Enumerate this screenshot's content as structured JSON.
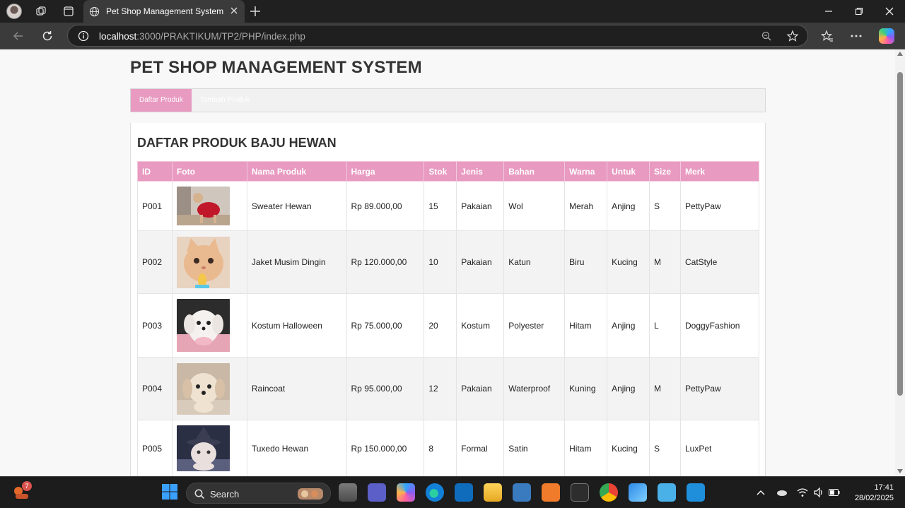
{
  "browser": {
    "tab_title": "Pet Shop Management System",
    "url_host": "localhost",
    "url_path": ":3000/PRAKTIKUM/TP2/PHP/index.php"
  },
  "page": {
    "title": "PET SHOP MANAGEMENT SYSTEM",
    "menu": [
      {
        "label": "Daftar Produk",
        "active": true
      },
      {
        "label": "Tambah Produk",
        "active": false
      }
    ],
    "section_title": "DAFTAR PRODUK BAJU HEWAN",
    "table": {
      "headers": [
        "ID",
        "Foto",
        "Nama Produk",
        "Harga",
        "Stok",
        "Jenis",
        "Bahan",
        "Warna",
        "Untuk",
        "Size",
        "Merk"
      ],
      "rows": [
        {
          "id": "P001",
          "photo": "dog in red sweater",
          "name": "Sweater Hewan",
          "price": "Rp 89.000,00",
          "stock": "15",
          "type": "Pakaian",
          "material": "Wol",
          "color": "Merah",
          "for": "Anjing",
          "size": "S",
          "brand": "PettyPaw"
        },
        {
          "id": "P002",
          "photo": "cat with praying hands",
          "name": "Jaket Musim Dingin",
          "price": "Rp 120.000,00",
          "stock": "10",
          "type": "Pakaian",
          "material": "Katun",
          "color": "Biru",
          "for": "Kucing",
          "size": "M",
          "brand": "CatStyle"
        },
        {
          "id": "P003",
          "photo": "white fluffy dog",
          "name": "Kostum Halloween",
          "price": "Rp 75.000,00",
          "stock": "20",
          "type": "Kostum",
          "material": "Polyester",
          "color": "Hitam",
          "for": "Anjing",
          "size": "L",
          "brand": "DoggyFashion"
        },
        {
          "id": "P004",
          "photo": "cream puppy",
          "name": "Raincoat",
          "price": "Rp 95.000,00",
          "stock": "12",
          "type": "Pakaian",
          "material": "Waterproof",
          "color": "Kuning",
          "for": "Anjing",
          "size": "M",
          "brand": "PettyPaw"
        },
        {
          "id": "P005",
          "photo": "cat in witch hat",
          "name": "Tuxedo Hewan",
          "price": "Rp 150.000,00",
          "stock": "8",
          "type": "Formal",
          "material": "Satin",
          "color": "Hitam",
          "for": "Kucing",
          "size": "S",
          "brand": "LuxPet"
        }
      ]
    }
  },
  "taskbar": {
    "search_label": "Search",
    "notification_count": "7",
    "time": "17:41",
    "date": "28/02/2025"
  },
  "colors": {
    "accent_pink": "#e89ac1",
    "chrome_dark": "#202020"
  }
}
